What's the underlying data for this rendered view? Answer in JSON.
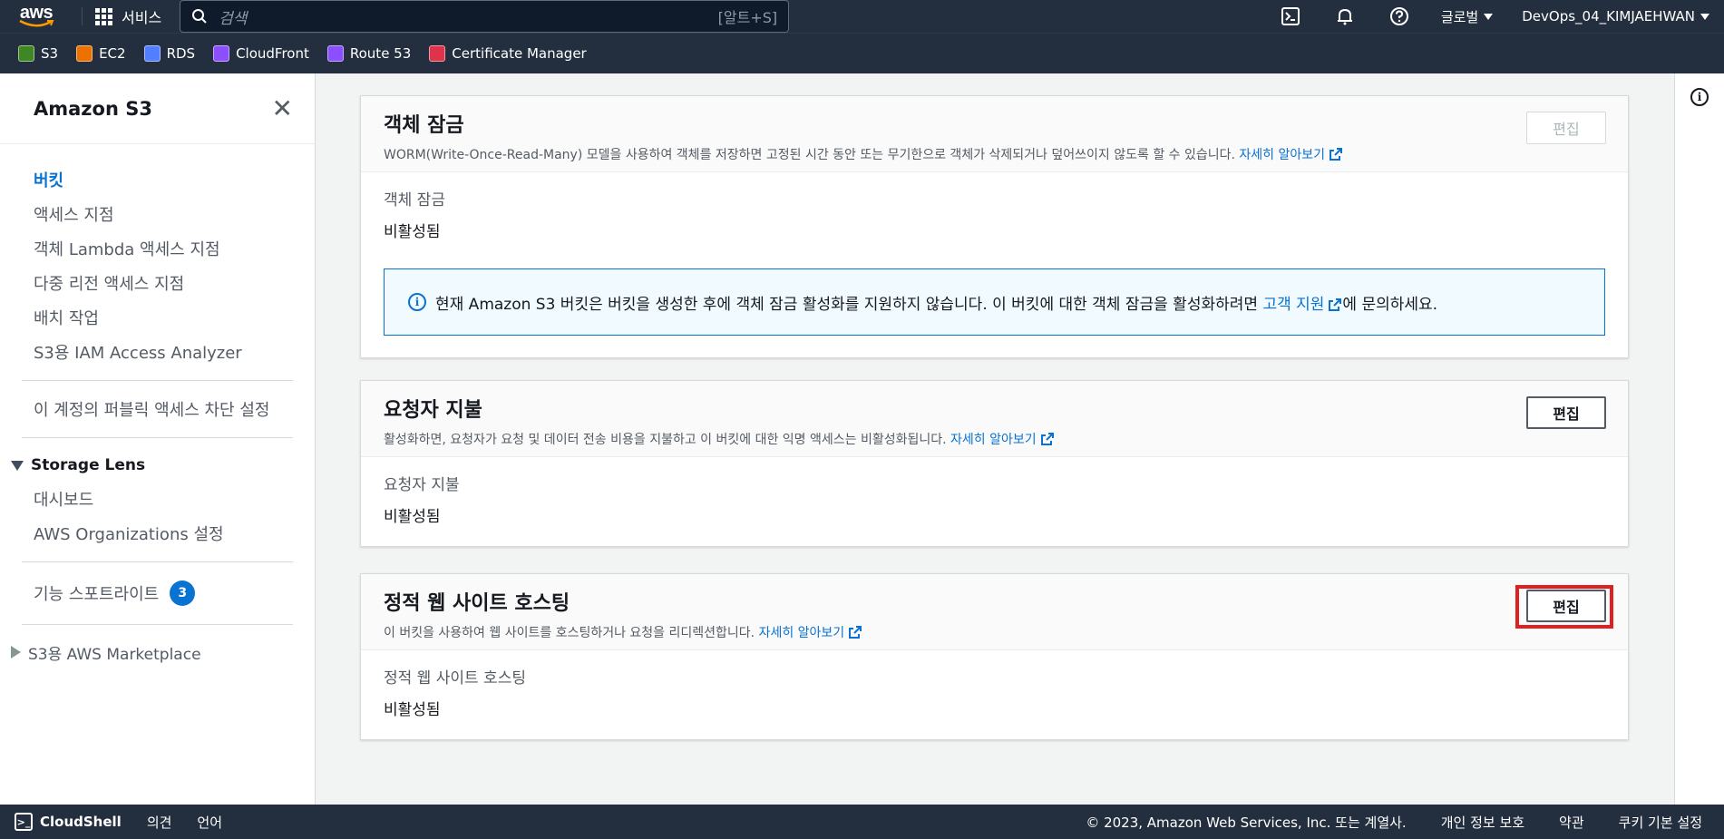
{
  "topnav": {
    "logo": "aws",
    "services": "서비스",
    "search_placeholder": "검색",
    "search_shortcut": "[알트+S]",
    "region": "글로벌",
    "user": "DevOps_04_KIMJAEHWAN"
  },
  "favorites": [
    {
      "label": "S3",
      "color": "#3f8624"
    },
    {
      "label": "EC2",
      "color": "#ed7100"
    },
    {
      "label": "RDS",
      "color": "#527fff"
    },
    {
      "label": "CloudFront",
      "color": "#8c4fff"
    },
    {
      "label": "Route 53",
      "color": "#8c4fff"
    },
    {
      "label": "Certificate Manager",
      "color": "#dd344c"
    }
  ],
  "sidebar": {
    "title": "Amazon S3",
    "items": [
      "버킷",
      "액세스 지점",
      "객체 Lambda 액세스 지점",
      "다중 리전 액세스 지점",
      "배치 작업",
      "S3용 IAM Access Analyzer"
    ],
    "block_public": "이 계정의 퍼블릭 액세스 차단 설정",
    "storage_lens": "Storage Lens",
    "lens_items": [
      "대시보드",
      "AWS Organizations 설정"
    ],
    "spotlight": "기능 스포트라이트",
    "spotlight_count": "3",
    "marketplace": "S3용 AWS Marketplace"
  },
  "cards": {
    "object_lock": {
      "title": "객체 잠금",
      "desc": "WORM(Write-Once-Read-Many) 모델을 사용하여 객체를 저장하면 고정된 시간 동안 또는 무기한으로 객체가 삭제되거나 덮어쓰이지 않도록 할 수 있습니다.",
      "link": "자세히 알아보기",
      "edit": "편집",
      "field_label": "객체 잠금",
      "field_value": "비활성됨",
      "alert_pre": "현재 Amazon S3 버킷은 버킷을 생성한 후에 객체 잠금 활성화를 지원하지 않습니다. 이 버킷에 대한 객체 잠금을 활성화하려면",
      "alert_link": "고객 지원",
      "alert_post": "에 문의하세요."
    },
    "requester_pays": {
      "title": "요청자 지불",
      "desc": "활성화하면, 요청자가 요청 및 데이터 전송 비용을 지불하고 이 버킷에 대한 익명 액세스는 비활성화됩니다.",
      "link": "자세히 알아보기",
      "edit": "편집",
      "field_label": "요청자 지불",
      "field_value": "비활성됨"
    },
    "static_hosting": {
      "title": "정적 웹 사이트 호스팅",
      "desc": "이 버킷을 사용하여 웹 사이트를 호스팅하거나 요청을 리디렉션합니다.",
      "link": "자세히 알아보기",
      "edit": "편집",
      "field_label": "정적 웹 사이트 호스팅",
      "field_value": "비활성됨"
    }
  },
  "footer": {
    "cloudshell": "CloudShell",
    "feedback": "의견",
    "language": "언어",
    "copyright": "© 2023, Amazon Web Services, Inc. 또는 계열사.",
    "privacy": "개인 정보 보호",
    "terms": "약관",
    "cookies": "쿠키 기본 설정"
  },
  "colors": {
    "link": "#0972d3",
    "nav_bg": "#232f3e",
    "highlight": "#e02020"
  }
}
